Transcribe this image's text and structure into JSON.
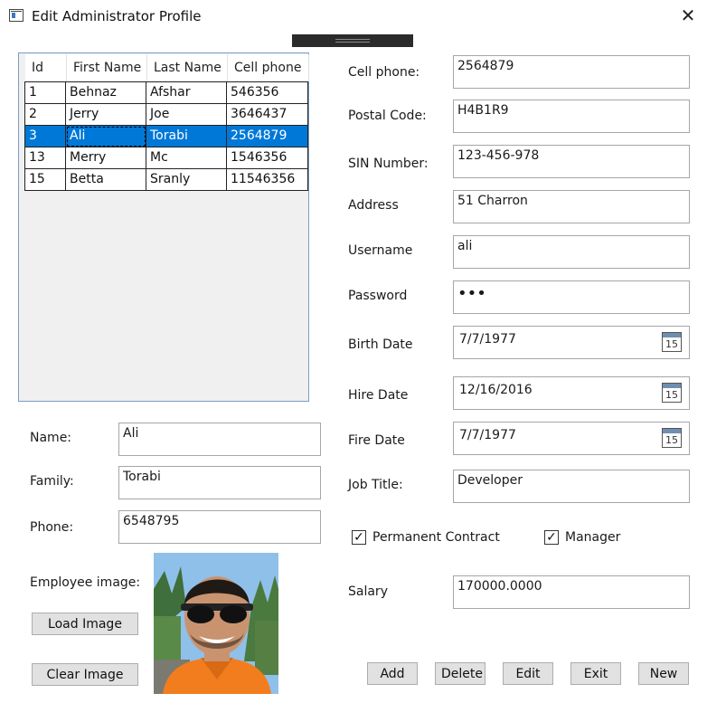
{
  "window": {
    "title": "Edit Administrator Profile",
    "close_glyph": "✕",
    "icon": "app-window-icon"
  },
  "grid": {
    "columns": [
      "Id",
      "First Name",
      "Last Name",
      "Cell phone"
    ],
    "rows": [
      [
        "1",
        "Behnaz",
        "Afshar",
        "546356"
      ],
      [
        "2",
        "Jerry",
        "Joe",
        "3646437"
      ],
      [
        "3",
        "Ali",
        "Torabi",
        "2564879"
      ],
      [
        "13",
        "Merry",
        "Mc",
        "1546356"
      ],
      [
        "15",
        "Betta",
        "Sranly",
        "11546356"
      ]
    ],
    "selected_row": 2
  },
  "left_form": {
    "name_label": "Name:",
    "name_value": "Ali",
    "family_label": "Family:",
    "family_value": "Torabi",
    "phone_label": "Phone:",
    "phone_value": "6548795",
    "employee_image_label": "Employee image:",
    "load_image_label": "Load Image",
    "clear_image_label": "Clear Image"
  },
  "right_form": {
    "cell_phone_label": "Cell phone:",
    "cell_phone_value": "2564879",
    "postal_code_label": "Postal Code:",
    "postal_code_value": "H4B1R9",
    "sin_label": "SIN Number:",
    "sin_value": "123-456-978",
    "address_label": "Address",
    "address_value": "51 Charron",
    "username_label": "Username",
    "username_value": "ali",
    "password_label": "Password",
    "password_value": "•••",
    "birth_date_label": "Birth Date",
    "birth_date_value": "7/7/1977",
    "hire_date_label": "Hire Date",
    "hire_date_value": "12/16/2016",
    "fire_date_label": "Fire Date",
    "fire_date_value": "7/7/1977",
    "calendar_day": "15",
    "job_title_label": "Job Title:",
    "job_title_value": "Developer",
    "permanent_contract_label": "Permanent Contract",
    "permanent_contract_checked": true,
    "manager_label": "Manager",
    "manager_checked": true,
    "check_glyph": "✓",
    "salary_label": "Salary",
    "salary_value": "170000.0000"
  },
  "actions": {
    "add": "Add",
    "delete": "Delete",
    "edit": "Edit",
    "exit": "Exit",
    "new": "New"
  },
  "colors": {
    "selection": "#0078d7",
    "button_face": "#e1e1e1",
    "field_border": "#a6a6a6",
    "grid_border": "#7a9cc8"
  }
}
